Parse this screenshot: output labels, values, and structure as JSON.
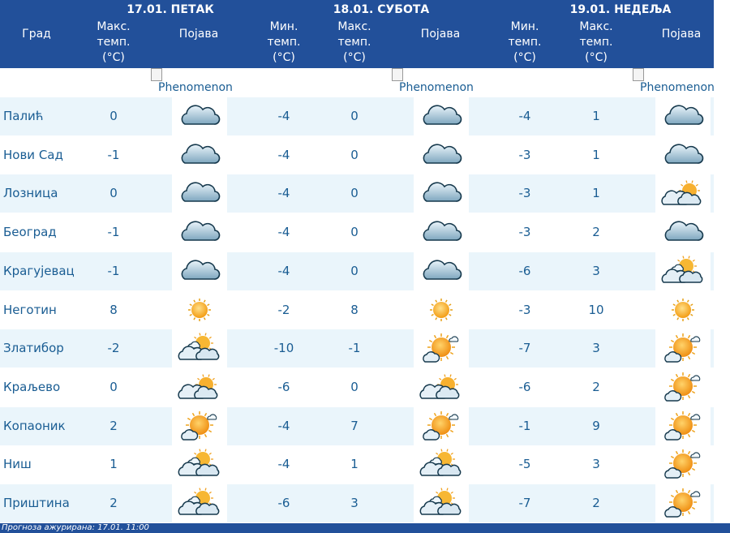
{
  "header": {
    "days": [
      "17.01. ПЕТАК",
      "18.01. СУБОТА",
      "19.01. НЕДЕЉА"
    ],
    "col_city": "Град",
    "col_max": [
      "Макс.",
      "темп.",
      "(°C)"
    ],
    "col_min": [
      "Мин.",
      "темп.",
      "(°C)"
    ],
    "col_phen": "Појава"
  },
  "broken_image_alt": "Phenomenon",
  "rows": [
    {
      "city": "Палић",
      "d1_max": "0",
      "d1_icon": "cloud-icon",
      "d2_min": "-4",
      "d2_max": "0",
      "d2_icon": "cloud-icon",
      "d3_min": "-4",
      "d3_max": "1",
      "d3_icon": "cloud-icon"
    },
    {
      "city": "Нови Сад",
      "d1_max": "-1",
      "d1_icon": "cloud-icon",
      "d2_min": "-4",
      "d2_max": "0",
      "d2_icon": "cloud-icon",
      "d3_min": "-3",
      "d3_max": "1",
      "d3_icon": "cloud-icon"
    },
    {
      "city": "Лозница",
      "d1_max": "0",
      "d1_icon": "cloud-icon",
      "d2_min": "-4",
      "d2_max": "0",
      "d2_icon": "cloud-icon",
      "d3_min": "-3",
      "d3_max": "1",
      "d3_icon": "cloudy-sun-icon"
    },
    {
      "city": "Београд",
      "d1_max": "-1",
      "d1_icon": "cloud-icon",
      "d2_min": "-4",
      "d2_max": "0",
      "d2_icon": "cloud-icon",
      "d3_min": "-3",
      "d3_max": "2",
      "d3_icon": "cloud-icon"
    },
    {
      "city": "Крагујевац",
      "d1_max": "-1",
      "d1_icon": "cloud-icon",
      "d2_min": "-4",
      "d2_max": "0",
      "d2_icon": "cloud-icon",
      "d3_min": "-6",
      "d3_max": "3",
      "d3_icon": "partly-sunny-icon"
    },
    {
      "city": "Неготин",
      "d1_max": "8",
      "d1_icon": "sun-icon",
      "d2_min": "-2",
      "d2_max": "8",
      "d2_icon": "sun-icon",
      "d3_min": "-3",
      "d3_max": "10",
      "d3_icon": "sun-icon"
    },
    {
      "city": "Златибор",
      "d1_max": "-2",
      "d1_icon": "partly-sunny-icon",
      "d2_min": "-10",
      "d2_max": "-1",
      "d2_icon": "mostly-sunny-icon",
      "d3_min": "-7",
      "d3_max": "3",
      "d3_icon": "mostly-sunny-icon"
    },
    {
      "city": "Краљево",
      "d1_max": "0",
      "d1_icon": "cloudy-sun-icon",
      "d2_min": "-6",
      "d2_max": "0",
      "d2_icon": "cloudy-sun-icon",
      "d3_min": "-6",
      "d3_max": "2",
      "d3_icon": "mostly-sunny-icon"
    },
    {
      "city": "Копаоник",
      "d1_max": "2",
      "d1_icon": "mostly-sunny-icon",
      "d2_min": "-4",
      "d2_max": "7",
      "d2_icon": "mostly-sunny-icon",
      "d3_min": "-1",
      "d3_max": "9",
      "d3_icon": "mostly-sunny-icon"
    },
    {
      "city": "Ниш",
      "d1_max": "1",
      "d1_icon": "partly-sunny-icon",
      "d2_min": "-4",
      "d2_max": "1",
      "d2_icon": "partly-sunny-icon",
      "d3_min": "-5",
      "d3_max": "3",
      "d3_icon": "mostly-sunny-icon"
    },
    {
      "city": "Приштина",
      "d1_max": "2",
      "d1_icon": "partly-sunny-icon",
      "d2_min": "-6",
      "d2_max": "3",
      "d2_icon": "partly-sunny-icon",
      "d3_min": "-7",
      "d3_max": "2",
      "d3_icon": "mostly-sunny-icon"
    }
  ],
  "footer": "Прогноза ажурирана:  17.01.  11:00",
  "colors": {
    "header_bg": "#22509a",
    "text": "#1a5d93",
    "row_alt": "#eaf5fb"
  }
}
